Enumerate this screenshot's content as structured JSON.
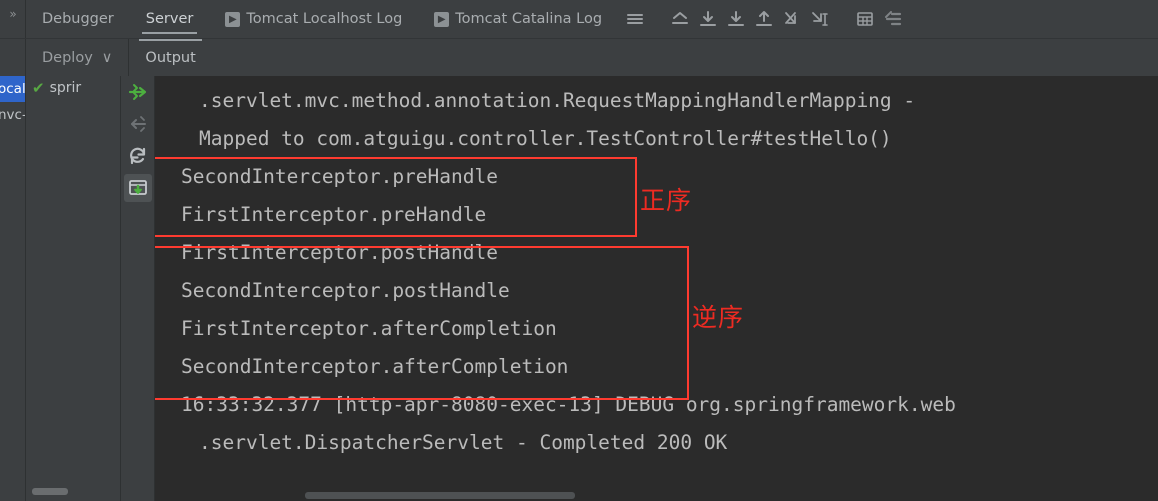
{
  "window": {
    "collapse_label": "»",
    "bg": "#3c3f41",
    "console_bg": "#2b2b2b",
    "accent_red": "#ff3b30",
    "accent_green": "#58a843",
    "selection_blue": "#2f65ca"
  },
  "toolwindow_tabs": [
    {
      "label": "Debugger",
      "active": false,
      "has_run_glyph": false
    },
    {
      "label": "Server",
      "active": true,
      "has_run_glyph": false
    },
    {
      "label": "Tomcat Localhost Log",
      "active": false,
      "has_run_glyph": true
    },
    {
      "label": "Tomcat Catalina Log",
      "active": false,
      "has_run_glyph": true
    }
  ],
  "toolbar_icons": [
    {
      "name": "menu-icon"
    },
    {
      "name": "soft-restart-icon"
    },
    {
      "name": "scroll-down-icon"
    },
    {
      "name": "download-icon"
    },
    {
      "name": "upload-icon"
    },
    {
      "name": "jump-to-start-icon"
    },
    {
      "name": "jump-to-end-icon"
    },
    {
      "name": "grid-icon"
    },
    {
      "name": "settings-lines-icon"
    }
  ],
  "sub_tabs": [
    {
      "label": "Deploy",
      "active": false,
      "chevron": "∨"
    },
    {
      "label": "Output",
      "active": true,
      "chevron": ""
    }
  ],
  "sliver_rows": [
    {
      "label": "ocal",
      "selected": true
    },
    {
      "label": "nvc-",
      "selected": false
    }
  ],
  "deploy_tree": {
    "node_label": "sprir",
    "check": "✔"
  },
  "action_strip": [
    {
      "name": "deploy-icon",
      "state": "enabled"
    },
    {
      "name": "undeploy-icon",
      "state": "disabled"
    },
    {
      "name": "redeploy-icon",
      "state": "enabled"
    },
    {
      "name": "update-application-icon",
      "state": "pressed"
    }
  ],
  "console": {
    "lines": [
      {
        "text": ".servlet.mvc.method.annotation.RequestMappingHandlerMapping -",
        "indent": 1
      },
      {
        "text": "Mapped to com.atguigu.controller.TestController#testHello()",
        "indent": 1
      },
      {
        "text": "SecondInterceptor.preHandle",
        "indent": 0
      },
      {
        "text": "FirstInterceptor.preHandle",
        "indent": 0
      },
      {
        "text": "FirstInterceptor.postHandle",
        "indent": 0
      },
      {
        "text": "SecondInterceptor.postHandle",
        "indent": 0
      },
      {
        "text": "FirstInterceptor.afterCompletion",
        "indent": 0
      },
      {
        "text": "SecondInterceptor.afterCompletion",
        "indent": 0
      },
      {
        "text": "16:33:32.377 [http-apr-8080-exec-13] DEBUG org.springframework.web",
        "indent": 0
      },
      {
        "text": ".servlet.DispatcherServlet - Completed 200 OK",
        "indent": 1
      }
    ]
  },
  "annotations": [
    {
      "name": "forward-order",
      "label": "正序"
    },
    {
      "name": "reverse-order",
      "label": "逆序"
    }
  ]
}
